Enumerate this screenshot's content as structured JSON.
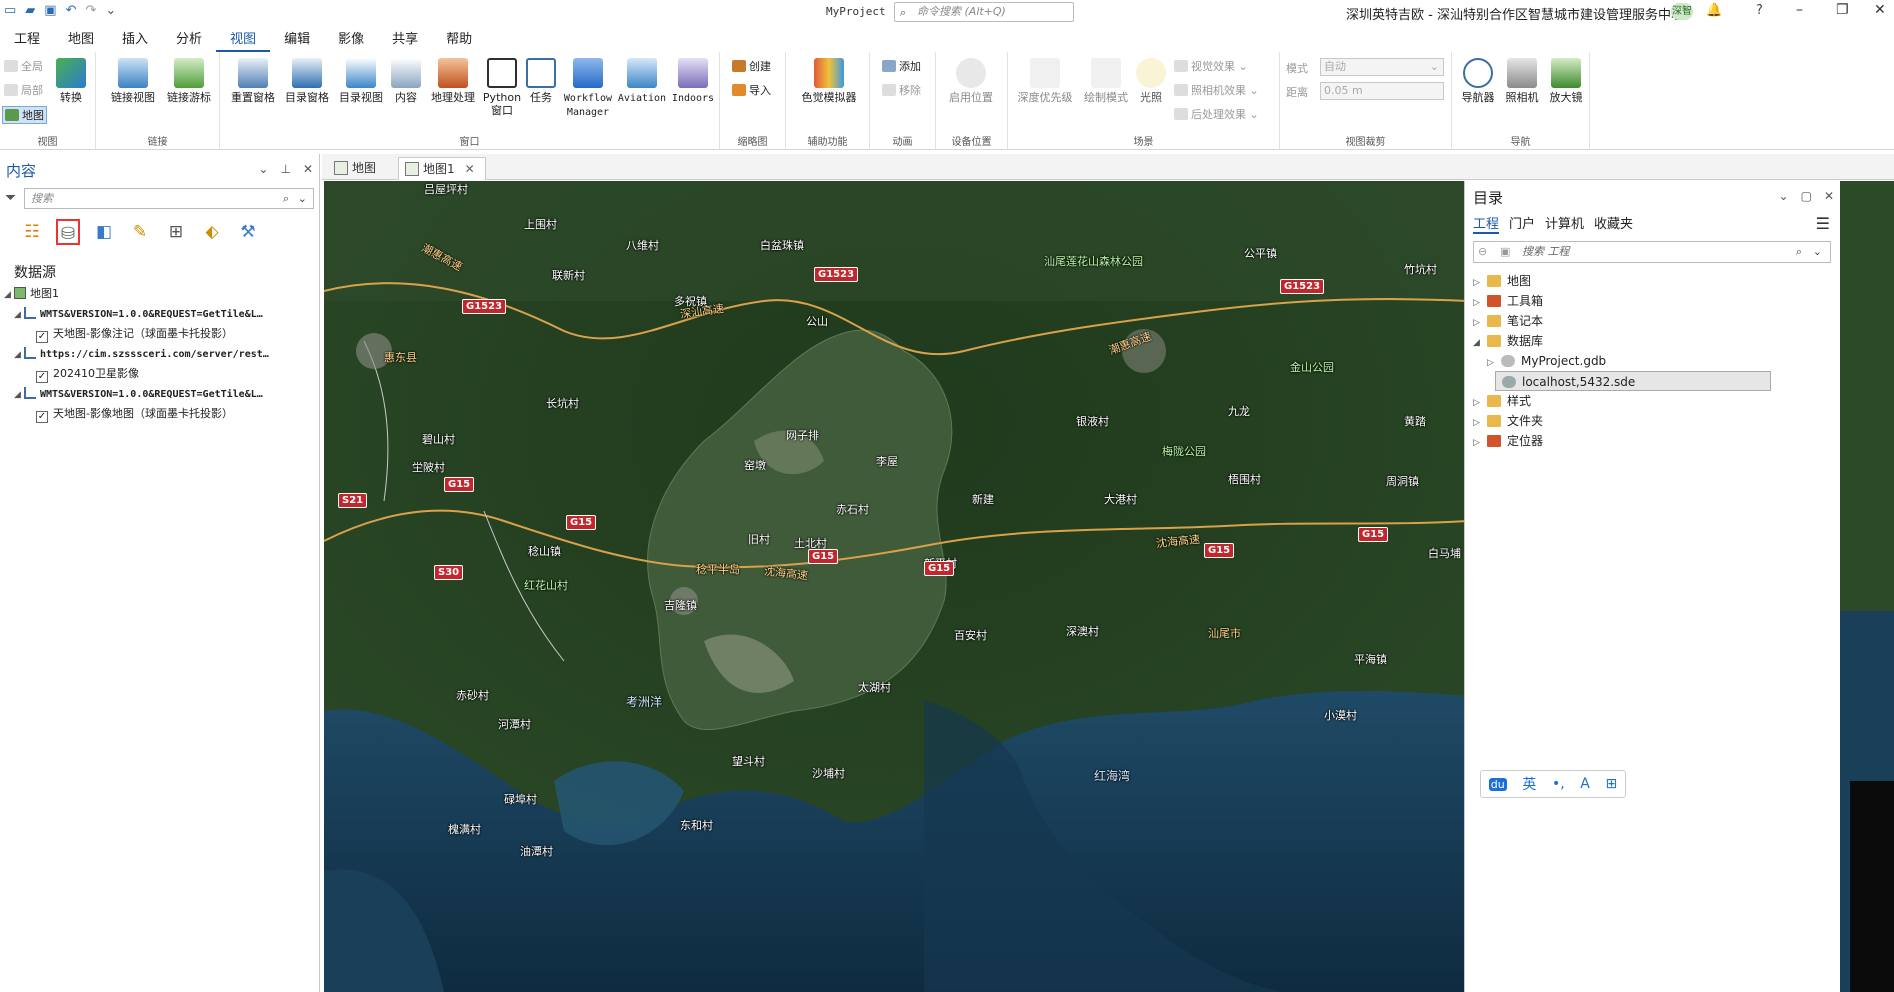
{
  "titlebar": {
    "project": "MyProject",
    "command_search_placeholder": "命令搜索 (Alt+Q)",
    "org": "深圳英特吉欧 - 深汕特别合作区智慧城市建设管理服务中心",
    "avatar": "深智",
    "help": "?"
  },
  "menus": [
    "工程",
    "地图",
    "插入",
    "分析",
    "视图",
    "编辑",
    "影像",
    "共享",
    "帮助"
  ],
  "active_menu": "视图",
  "ribbon": {
    "view": {
      "full_extent": "全局",
      "partial": "局部",
      "map": "地图",
      "convert": "转换",
      "label": "视图"
    },
    "link": {
      "link_views": "链接视图",
      "link_cursor": "链接游标",
      "label": "链接"
    },
    "window": {
      "reset_panes": "重置窗格",
      "catalog_pane": "目录窗格",
      "catalog_view": "目录视图",
      "contents": "内容",
      "geoprocessing": "地理处理",
      "python_1": "Python",
      "python_2": "窗口",
      "tasks": "任务",
      "workflow_1": "Workflow",
      "workflow_2": "Manager",
      "aviation": "Aviation",
      "indoors": "Indoors",
      "label": "窗口"
    },
    "thumbnail": {
      "create": "创建",
      "import": "导入",
      "label": "缩略图"
    },
    "accessibility": {
      "color_vision": "色觉模拟器",
      "label": "辅助功能"
    },
    "animation": {
      "add": "添加",
      "remove": "移除",
      "label": "动画"
    },
    "device": {
      "enable_location": "启用位置",
      "label": "设备位置"
    },
    "scene": {
      "depth_priority": "深度优先级",
      "draw_mode": "绘制模式",
      "lighting": "光照",
      "visual_effects": "视觉效果",
      "camera_effects": "照相机效果",
      "post_effects": "后处理效果",
      "label": "场景"
    },
    "view_clipping": {
      "mode_label": "模式",
      "mode_value": "自动",
      "distance_label": "距离",
      "distance_value": "0.05 m",
      "label": "视图裁剪"
    },
    "navigate": {
      "navigator": "导航器",
      "camera": "照相机",
      "magnifier": "放大镜",
      "label": "导航"
    }
  },
  "contents_pane": {
    "title": "内容",
    "search_placeholder": "搜索",
    "section": "数据源",
    "map_name": "地图1",
    "layers": [
      {
        "source": "WMTS&VERSION=1.0.0&REQUEST=GetTile&L…",
        "layer": "天地图-影像注记（球面墨卡托投影）"
      },
      {
        "source": "https://cim.szsssceri.com/server/rest…",
        "layer": "202410卫星影像"
      },
      {
        "source": "WMTS&VERSION=1.0.0&REQUEST=GetTile&L…",
        "layer": "天地图-影像地图（球面墨卡托投影）"
      }
    ]
  },
  "map_tabs": [
    {
      "label": "地图"
    },
    {
      "label": "地图1"
    }
  ],
  "map_labels": [
    "吕屋坪村",
    "上围村",
    "八维村",
    "白盆珠镇",
    "联新村",
    "多祝镇",
    "公山",
    "汕尾莲花山森林公园",
    "公平镇",
    "惠东县",
    "长坑村",
    "碧山村",
    "网子排",
    "李屋",
    "窑墩",
    "银液村",
    "九龙",
    "黄踏",
    "坣陂村",
    "梧围村",
    "周洞镇",
    "新建",
    "大港村",
    "赤石村",
    "稔山镇",
    "旧村",
    "土北村",
    "新平村",
    "白马埔",
    "吉隆镇",
    "稔平半岛",
    "百安村",
    "深澳村",
    "汕尾市",
    "赤砂村",
    "河潭村",
    "太湖村",
    "考洲洋",
    "望斗村",
    "沙埔村",
    "碌埠村",
    "红海湾",
    "槐满村",
    "东和村",
    "油潭村",
    "金山公园",
    "梅陇公园",
    "红花山村",
    "小漠村",
    "竹坑村",
    "平海镇"
  ],
  "map_highways": [
    "G1523",
    "G1523",
    "G1523",
    "G15",
    "G15",
    "G15",
    "G15",
    "G15",
    "G15",
    "S21",
    "S30"
  ],
  "road_names": [
    "潮惠高速",
    "深汕高速",
    "沈海高速",
    "沈海高速",
    "潮惠高速"
  ],
  "catalog_pane": {
    "title": "目录",
    "tabs": [
      "工程",
      "门户",
      "计算机",
      "收藏夹"
    ],
    "search_placeholder": "搜索 工程",
    "items": [
      "地图",
      "工具箱",
      "笔记本",
      "数据库",
      "MyProject.gdb",
      "localhost,5432.sde",
      "样式",
      "文件夹",
      "定位器"
    ]
  },
  "ime": [
    "du",
    "英",
    "•,",
    "A",
    "⊞"
  ]
}
